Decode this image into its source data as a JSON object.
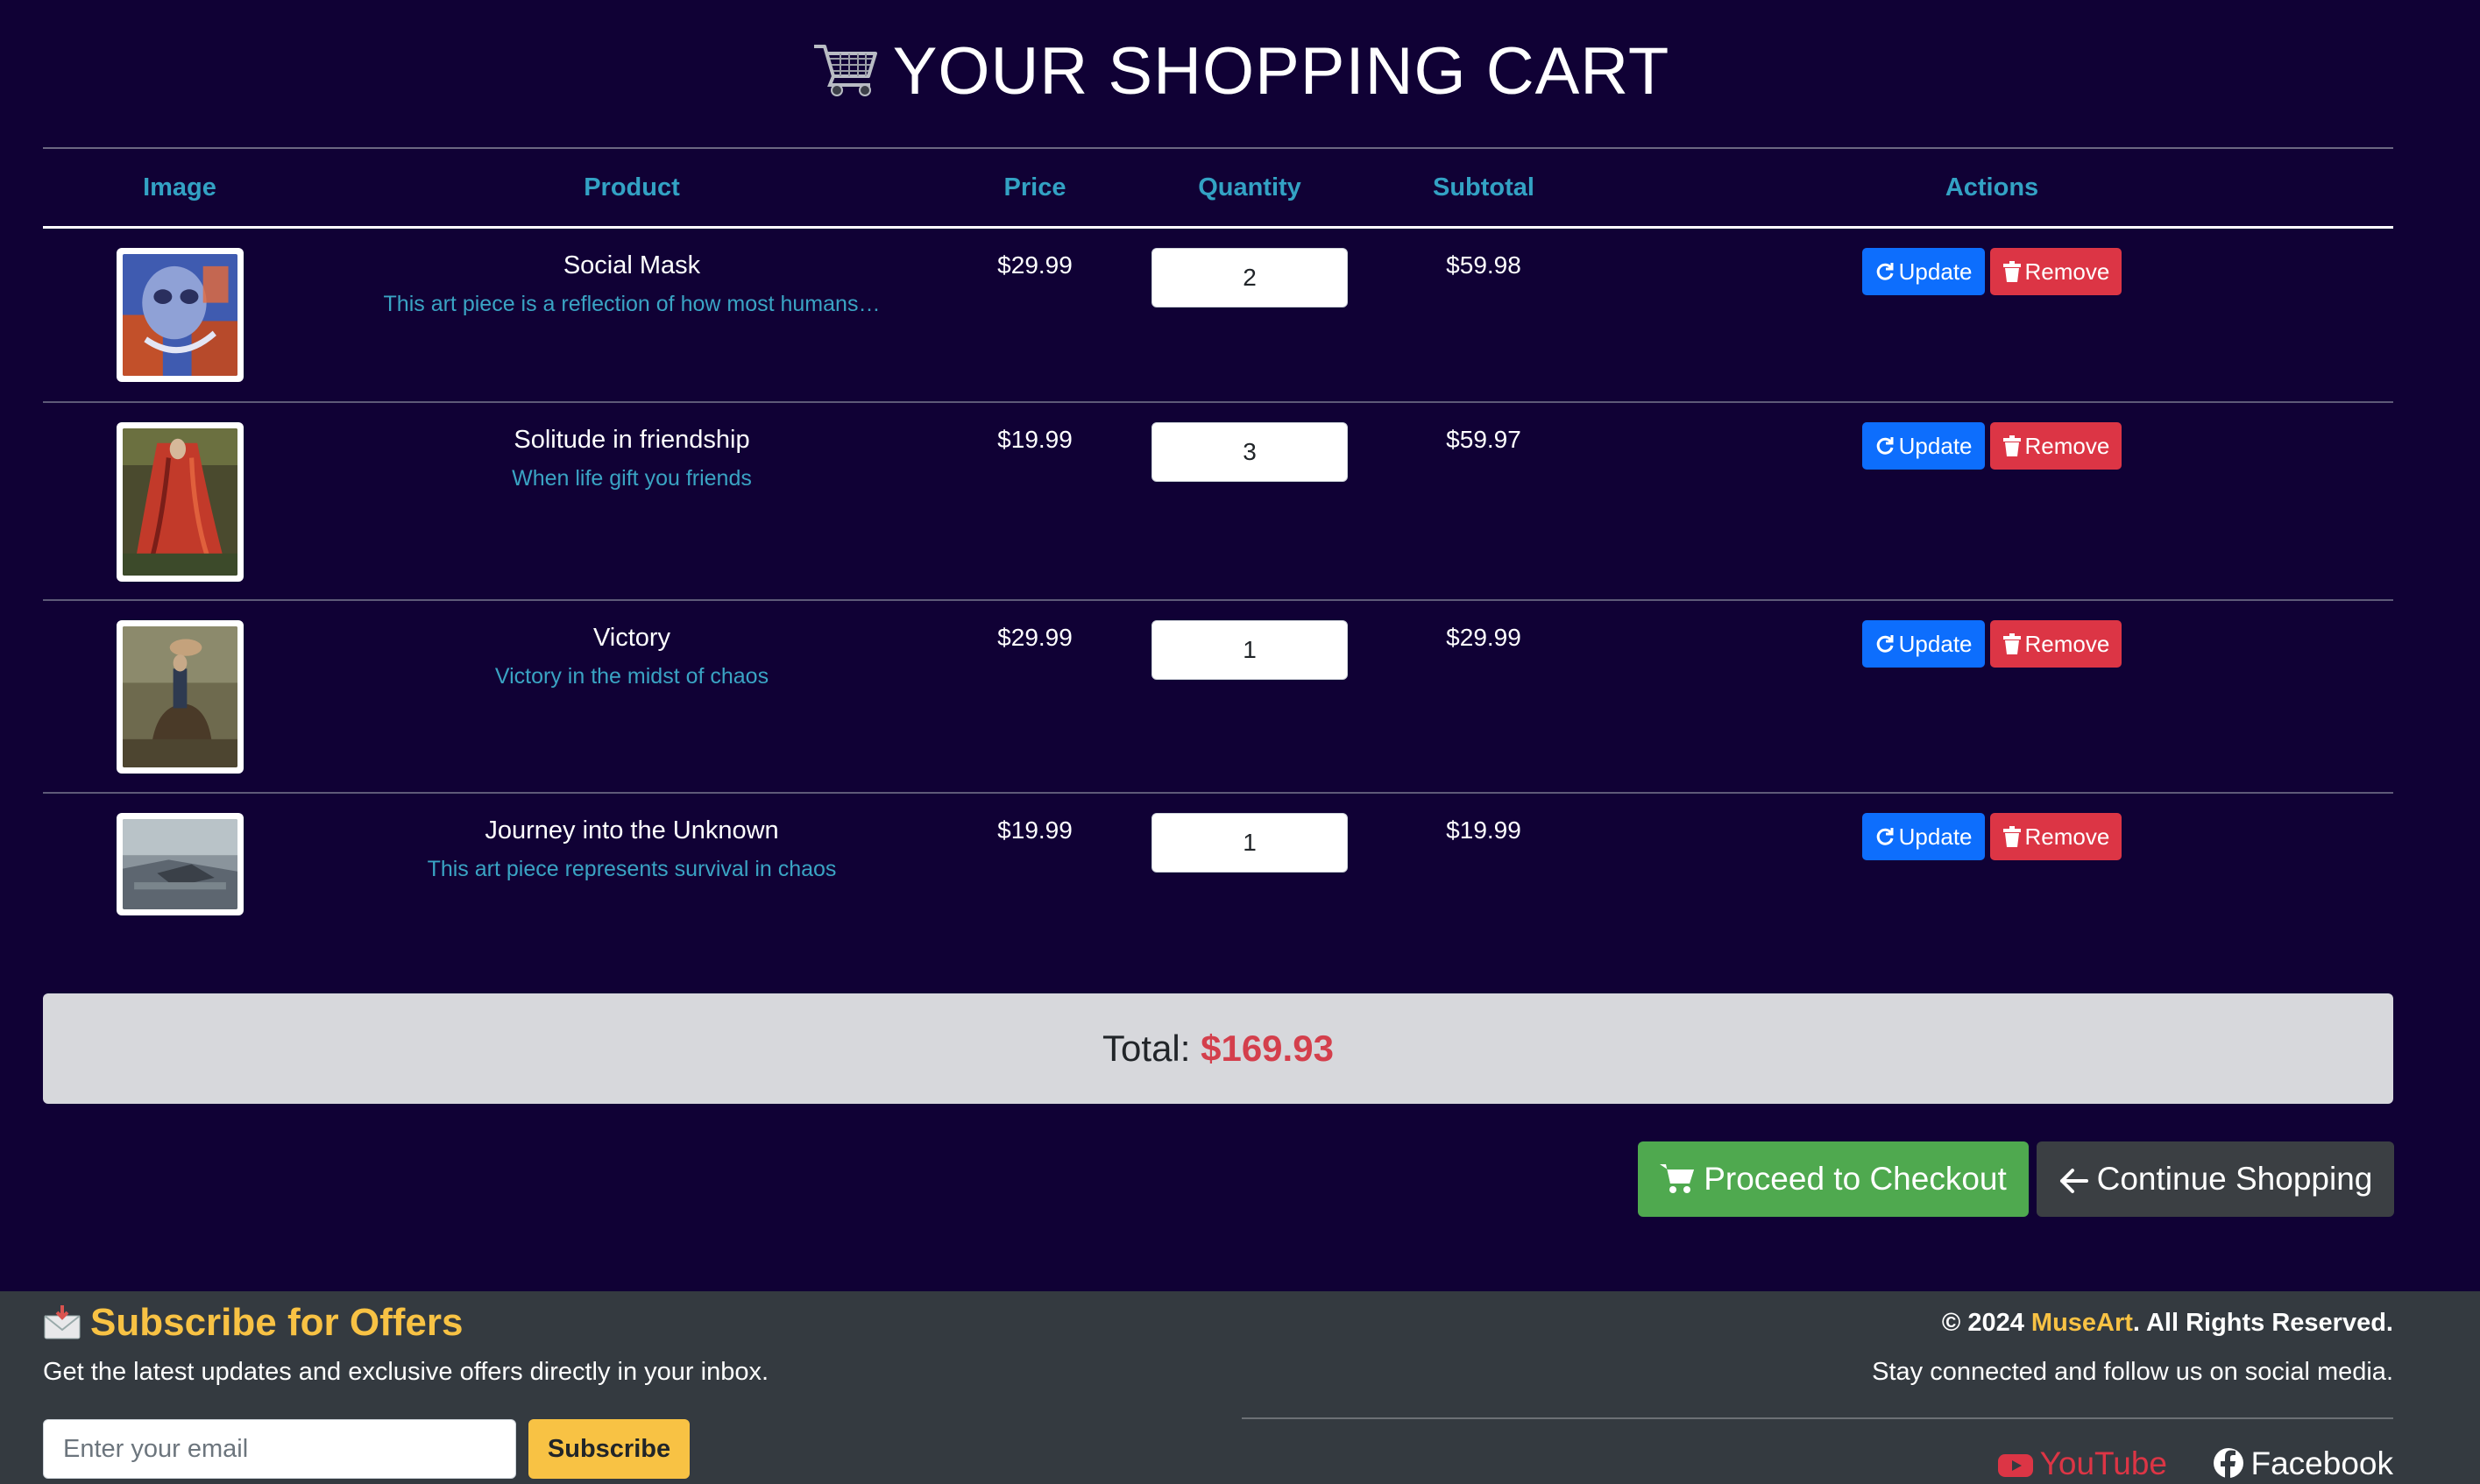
{
  "page": {
    "title": "YOUR SHOPPING CART"
  },
  "table": {
    "headers": {
      "image": "Image",
      "product": "Product",
      "price": "Price",
      "quantity": "Quantity",
      "subtotal": "Subtotal",
      "actions": "Actions"
    },
    "rows": [
      {
        "name": "Social Mask",
        "description": "This art piece is a reflection of how most humans…",
        "price": "$29.99",
        "quantity": "2",
        "subtotal": "$59.98"
      },
      {
        "name": "Solitude in friendship",
        "description": "When life gift you friends",
        "price": "$19.99",
        "quantity": "3",
        "subtotal": "$59.97"
      },
      {
        "name": "Victory",
        "description": "Victory in the midst of chaos",
        "price": "$29.99",
        "quantity": "1",
        "subtotal": "$29.99"
      },
      {
        "name": "Journey into the Unknown",
        "description": "This art piece represents survival in chaos",
        "price": "$19.99",
        "quantity": "1",
        "subtotal": "$19.99"
      }
    ],
    "update_label": "Update",
    "remove_label": "Remove"
  },
  "summary": {
    "total_label": "Total:",
    "total_value": "$169.93"
  },
  "buttons": {
    "checkout": "Proceed to Checkout",
    "continue": "Continue Shopping"
  },
  "footer": {
    "subscribe_title": "Subscribe for Offers",
    "subscribe_text": "Get the latest updates and exclusive offers directly in your inbox.",
    "email_placeholder": "Enter your email",
    "subscribe_button": "Subscribe",
    "copyright_prefix": "© 2024",
    "brand": "MuseArt",
    "copyright_suffix": ". All Rights Reserved.",
    "follow_text": "Stay connected and follow us on social media.",
    "youtube": "YouTube",
    "facebook": "Facebook"
  },
  "colors": {
    "background": "#100135",
    "header_text": "#33a2c4",
    "update": "#0d6efd",
    "remove": "#dc3545",
    "checkout": "#4fa94f",
    "continue": "#3b3f43",
    "accent": "#f8c244",
    "total_value": "#d43f4c"
  },
  "icons": {
    "title": "shopping-cart-icon",
    "update": "refresh-icon",
    "remove": "trash-icon",
    "checkout": "cart-icon",
    "continue": "arrow-left-icon",
    "subscribe": "envelope-icon",
    "youtube": "youtube-icon",
    "facebook": "facebook-icon"
  }
}
